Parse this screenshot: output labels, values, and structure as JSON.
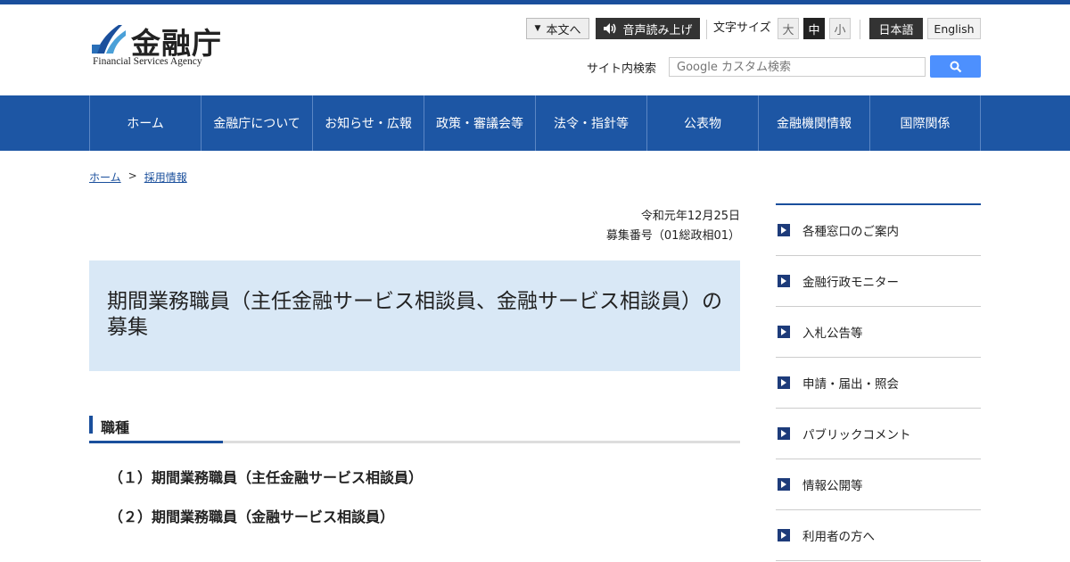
{
  "header": {
    "logo_jp": "金融庁",
    "logo_en": "Financial Services Agency",
    "skip_to_content": "本文へ",
    "read_aloud": "音声読み上げ",
    "font_size_label": "文字サイズ",
    "font_sizes": [
      "大",
      "中",
      "小"
    ],
    "lang_ja": "日本語",
    "lang_en": "English",
    "search_label": "サイト内検索",
    "search_placeholder": "Google カスタム検索"
  },
  "nav": [
    "ホーム",
    "金融庁について",
    "お知らせ・広報",
    "政策・審議会等",
    "法令・指針等",
    "公表物",
    "金融機関情報",
    "国際関係"
  ],
  "breadcrumb": {
    "home": "ホーム",
    "sep": ">",
    "current": "採用情報"
  },
  "main": {
    "date": "令和元年12月25日",
    "recruit_no": "募集番号（01総政相01）",
    "title": "期間業務職員（主任金融サービス相談員、金融サービス相談員）の募集",
    "section_title": "職種",
    "jobs": [
      "（１）期間業務職員（主任金融サービス相談員）",
      "（２）期間業務職員（金融サービス相談員）"
    ]
  },
  "sidebar": [
    "各種窓口のご案内",
    "金融行政モニター",
    "入札公告等",
    "申請・届出・照会",
    "パブリックコメント",
    "情報公開等",
    "利用者の方へ"
  ],
  "colors": {
    "brand": "#1d56a4",
    "title_bg": "#d9e8f6",
    "search_button": "#4d90fe"
  }
}
